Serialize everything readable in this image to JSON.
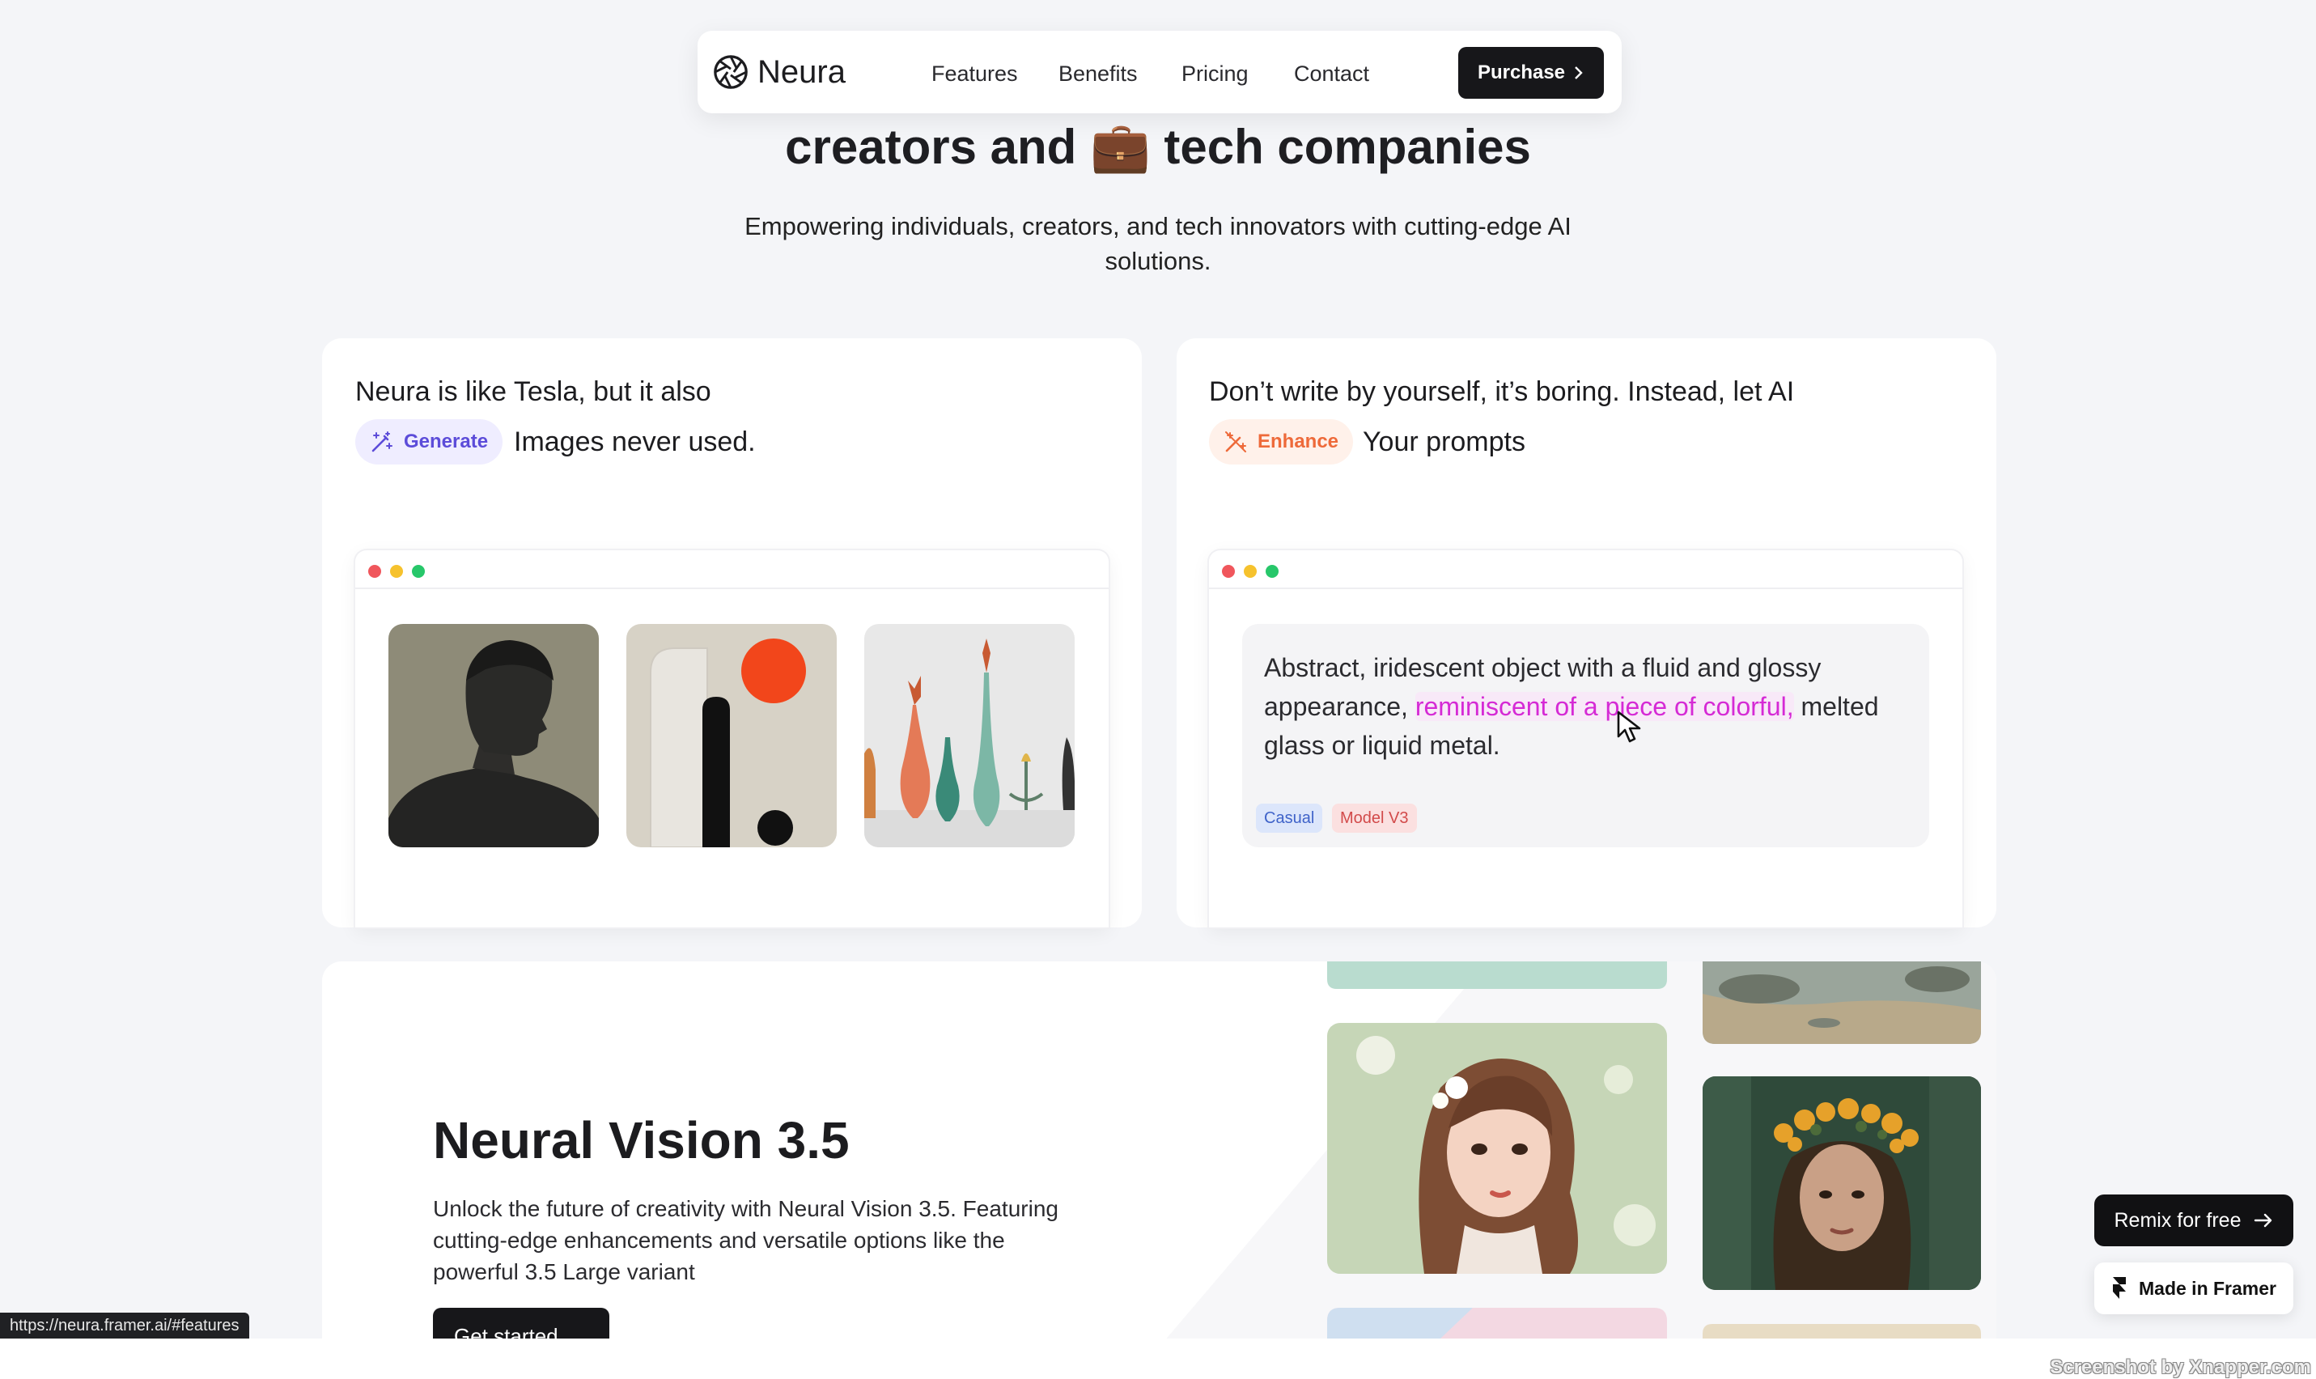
{
  "nav": {
    "brand": "Neura",
    "links": [
      "Features",
      "Benefits",
      "Pricing",
      "Contact"
    ],
    "purchase_label": "Purchase"
  },
  "hero": {
    "title_before": "creators and",
    "title_emoji": "💼",
    "title_after": "tech companies",
    "subtitle": "Empowering individuals, creators, and tech innovators with cutting-edge AI solutions."
  },
  "card_generate": {
    "line1": "Neura is like Tesla, but it also",
    "pill_label": "Generate",
    "line2": "Images never used."
  },
  "card_enhance": {
    "line1": "Don’t write by yourself, it’s boring. Instead, let AI",
    "pill_label": "Enhance",
    "line2": "Your prompts",
    "prompt_before": "Abstract, iridescent object with a fluid and glossy appearance, ",
    "prompt_highlight": "reminiscent of a piece of colorful,",
    "prompt_after": " melted glass or liquid metal.",
    "tags": [
      "Casual",
      "Model V3"
    ]
  },
  "neural_vision": {
    "title": "Neural Vision 3.5",
    "description": "Unlock the future of creativity with Neural Vision 3.5. Featuring cutting-edge enhancements and versatile options like the powerful 3.5 Large variant",
    "cta_label": "Get started"
  },
  "floating": {
    "remix_label": "Remix for free",
    "framer_label": "Made in Framer"
  },
  "status_url": "https://neura.framer.ai/#features",
  "watermark": "Screenshot by Xnapper.com",
  "colors": {
    "accent_dark": "#17171a",
    "generate_purple": "#5c4cd9",
    "enhance_orange": "#ee6a3a",
    "highlight_magenta": "#d52ad5",
    "background": "#f4f5f8"
  },
  "icons": {
    "logo": "aperture-icon",
    "generate": "magic-wand-icon",
    "enhance": "magic-wand-off-icon",
    "purchase": "chevron-right-icon",
    "remix": "arrow-right-icon",
    "framer": "framer-logo-icon"
  }
}
